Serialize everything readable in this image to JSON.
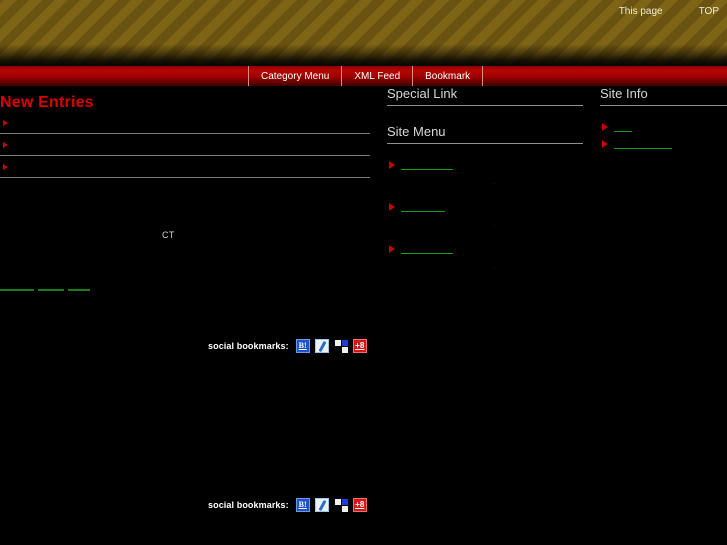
{
  "header": {
    "links": [
      {
        "label": "This page",
        "name": "this-page-link"
      },
      {
        "label": "TOP",
        "name": "top-link"
      }
    ]
  },
  "nav": {
    "items": [
      {
        "label": "Category Menu"
      },
      {
        "label": "XML Feed"
      },
      {
        "label": "Bookmark"
      }
    ]
  },
  "left": {
    "title": "New Entries",
    "entries": [
      {
        "text": ""
      },
      {
        "text": ""
      },
      {
        "text": ""
      }
    ],
    "ct_marker": "CT",
    "green_links": [
      {
        "text": ""
      },
      {
        "text": ""
      },
      {
        "text": ""
      }
    ]
  },
  "social": {
    "label": "social bookmarks:",
    "icons": [
      {
        "name": "hatena-bookmark-icon",
        "glyph": "B!"
      },
      {
        "name": "livedoor-clip-icon",
        "glyph": ""
      },
      {
        "name": "delicious-icon",
        "glyph": ""
      },
      {
        "name": "yahoo-bookmark-icon",
        "glyph": "+8"
      }
    ]
  },
  "middle": {
    "special_link_heading": "Special Link",
    "site_menu_heading": "Site Menu",
    "site_menu_items": [
      {
        "label": "",
        "meta": "..."
      },
      {
        "label": "",
        "meta": "..."
      },
      {
        "label": "",
        "meta": "..."
      }
    ]
  },
  "right": {
    "site_info_heading": "Site Info",
    "site_info_items": [
      {
        "label": ""
      },
      {
        "label": ""
      }
    ]
  },
  "colors": {
    "accent_red": "#cc0000",
    "link_green": "#2aa02a",
    "nav_red": "#b50505",
    "banner_olive": "#6a5310",
    "heading_gray": "#d7d7d7"
  }
}
